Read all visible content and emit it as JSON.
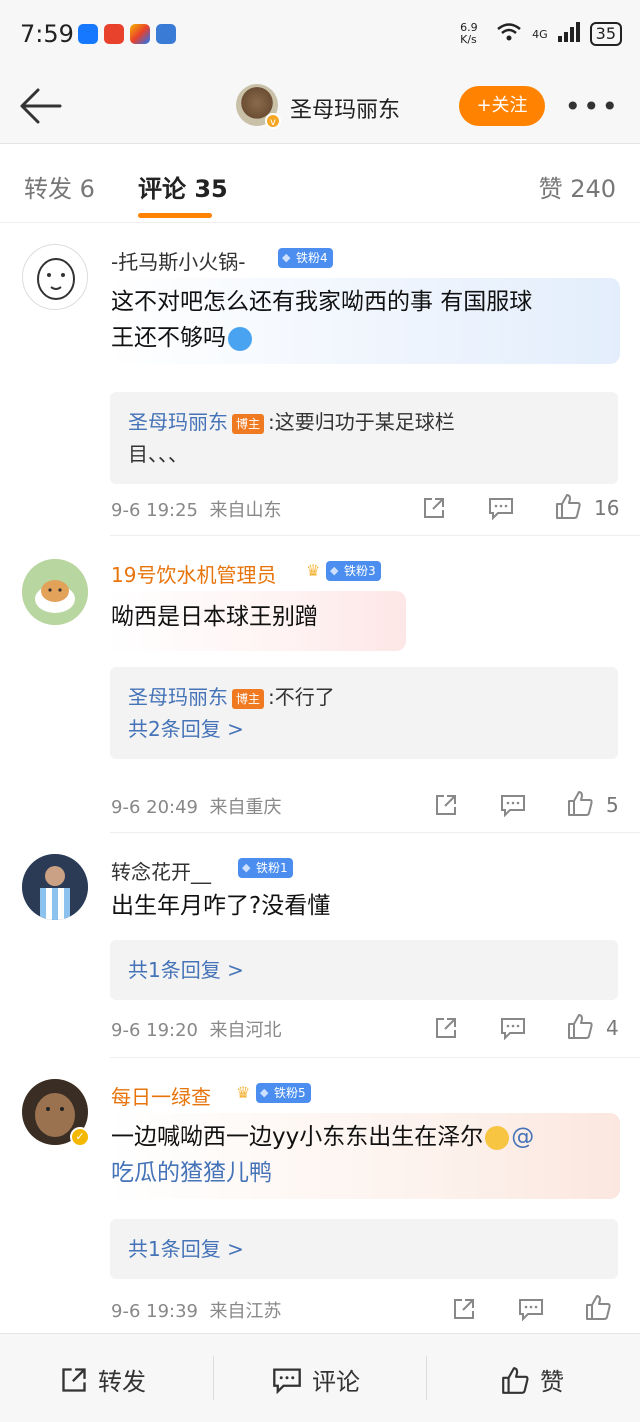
{
  "status_bar": {
    "time": "7:59",
    "net_speed": "6.9 K/s",
    "network": "4G",
    "battery": "35"
  },
  "header": {
    "title": "圣母玛丽东",
    "follow_label": "+关注"
  },
  "tabs": {
    "repost": "转发 6",
    "comment": "评论 35",
    "like": "赞 240"
  },
  "comments": [
    {
      "user": "-托马斯小火锅-",
      "fan_badge": "铁粉4",
      "text_line1": "这不对吧怎么还有我家呦西的事 有国服球",
      "text_line2": "王还不够吗",
      "reply": {
        "name": "圣母玛丽东",
        "tag": "博主",
        "text1": ":这要归功于某足球栏",
        "text2": "目、、、"
      },
      "time": "9-6 19:25",
      "location": "来自山东",
      "likes": "16"
    },
    {
      "user": "19号饮水机管理员",
      "fan_badge": "铁粉3",
      "text_line1": "呦西是日本球王别蹭",
      "reply": {
        "name": "圣母玛丽东",
        "tag": "博主",
        "text1": ":不行了",
        "more": "共2条回复 >"
      },
      "time": "9-6 20:49",
      "location": "来自重庆",
      "likes": "5"
    },
    {
      "user": "转念花开__",
      "fan_badge": "铁粉1",
      "text_line1": "出生年月咋了?没看懂",
      "reply": {
        "more": "共1条回复 >"
      },
      "time": "9-6 19:20",
      "location": "来自河北",
      "likes": "4"
    },
    {
      "user": "每日一绿查",
      "fan_badge": "铁粉5",
      "text_line1": "一边喊呦西一边yy小东东出生在泽尔",
      "mention": "@",
      "text_line2": "吃瓜的猹猹儿鸭",
      "reply": {
        "more": "共1条回复 >"
      },
      "time": "9-6 19:39",
      "location": "来自江苏",
      "likes": ""
    }
  ],
  "bottom_bar": {
    "repost": "转发",
    "comment": "评论",
    "like": "赞"
  },
  "colors": {
    "accent": "#ff8200",
    "link": "#4573b8",
    "fan_badge": "#4b8ef0",
    "owner_tag": "#f07a22"
  }
}
